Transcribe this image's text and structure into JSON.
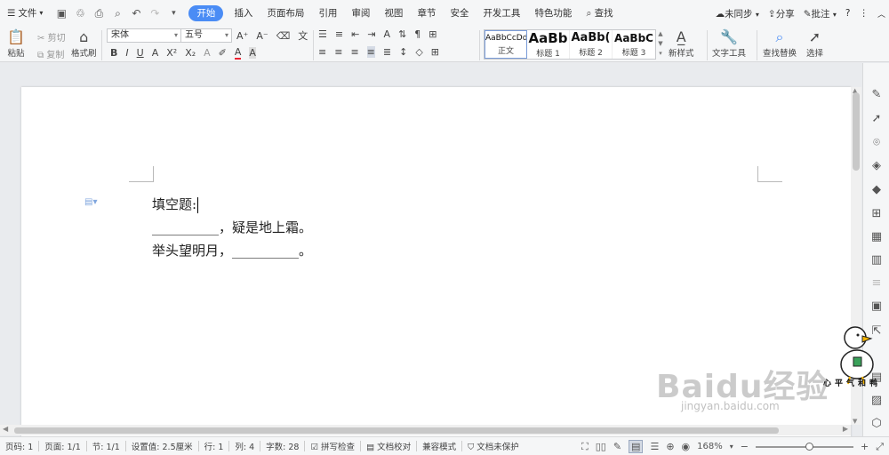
{
  "menubar": {
    "file_label": "文件",
    "tabs": [
      "开始",
      "插入",
      "页面布局",
      "引用",
      "审阅",
      "视图",
      "章节",
      "安全",
      "开发工具",
      "特色功能"
    ],
    "active_tab": "开始",
    "search_label": "查找",
    "sync_label": "未同步",
    "share_label": "分享",
    "comment_label": "批注"
  },
  "ribbon": {
    "paste_label": "粘贴",
    "cut_label": "剪切",
    "copy_label": "复制",
    "format_painter_label": "格式刷",
    "font_name": "宋体",
    "font_size": "五号",
    "styles": [
      {
        "preview": "AaBbCcDd",
        "name": "正文"
      },
      {
        "preview": "AaBb",
        "name": "标题 1"
      },
      {
        "preview": "AaBb(",
        "name": "标题 2"
      },
      {
        "preview": "AaBbC",
        "name": "标题 3"
      }
    ],
    "new_style_label": "新样式",
    "text_tools_label": "文字工具",
    "find_replace_label": "查找替换",
    "select_label": "选择"
  },
  "document": {
    "lines": [
      "填空题:",
      "__________，疑是地上霜。",
      "举头望明月，__________。"
    ]
  },
  "watermark": {
    "brand": "Baidu经验",
    "url": "jingyan.baidu.com",
    "signature": "心平气和鸭"
  },
  "statusbar": {
    "page_code": "页码: 1",
    "pages": "页面: 1/1",
    "section": "节: 1/1",
    "setting": "设置值: 2.5厘米",
    "row": "行: 1",
    "col": "列: 4",
    "word_count": "字数: 28",
    "spell_check": "拼写检查",
    "doc_proof": "文档校对",
    "compat_mode": "兼容模式",
    "protect": "文档未保护",
    "zoom": "168%",
    "zoom_level": 0.55
  }
}
